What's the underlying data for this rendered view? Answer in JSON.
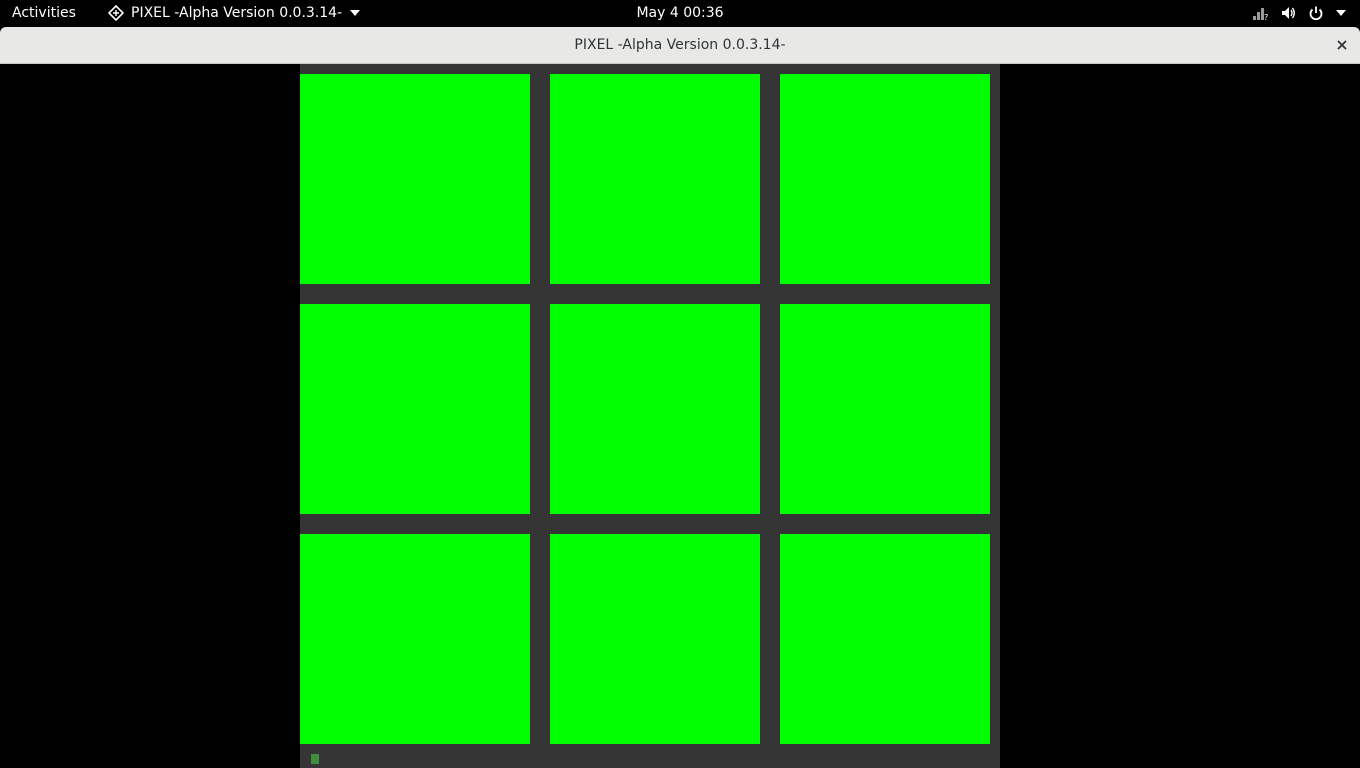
{
  "topbar": {
    "activities_label": "Activities",
    "app_menu_label": "PIXEL -Alpha Version 0.0.3.14-",
    "clock": "May 4  00:36",
    "icons": [
      "app-icon",
      "network-icon",
      "volume-icon",
      "power-icon",
      "chevron-down-icon"
    ]
  },
  "window": {
    "title": "PIXEL -Alpha Version 0.0.3.14-",
    "close_icon": "close-icon"
  },
  "game": {
    "board_color": "#353535",
    "tile_color": "#00ff00",
    "rows": 3,
    "cols": 3,
    "tiles": [
      {
        "row": 1,
        "col": 1,
        "color": "#00ff00"
      },
      {
        "row": 1,
        "col": 2,
        "color": "#00ff00"
      },
      {
        "row": 1,
        "col": 3,
        "color": "#00ff00"
      },
      {
        "row": 2,
        "col": 1,
        "color": "#00ff00"
      },
      {
        "row": 2,
        "col": 2,
        "color": "#00ff00"
      },
      {
        "row": 2,
        "col": 3,
        "color": "#00ff00"
      },
      {
        "row": 3,
        "col": 1,
        "color": "#00ff00"
      },
      {
        "row": 3,
        "col": 2,
        "color": "#00ff00"
      },
      {
        "row": 3,
        "col": 3,
        "color": "#00ff00"
      }
    ]
  }
}
